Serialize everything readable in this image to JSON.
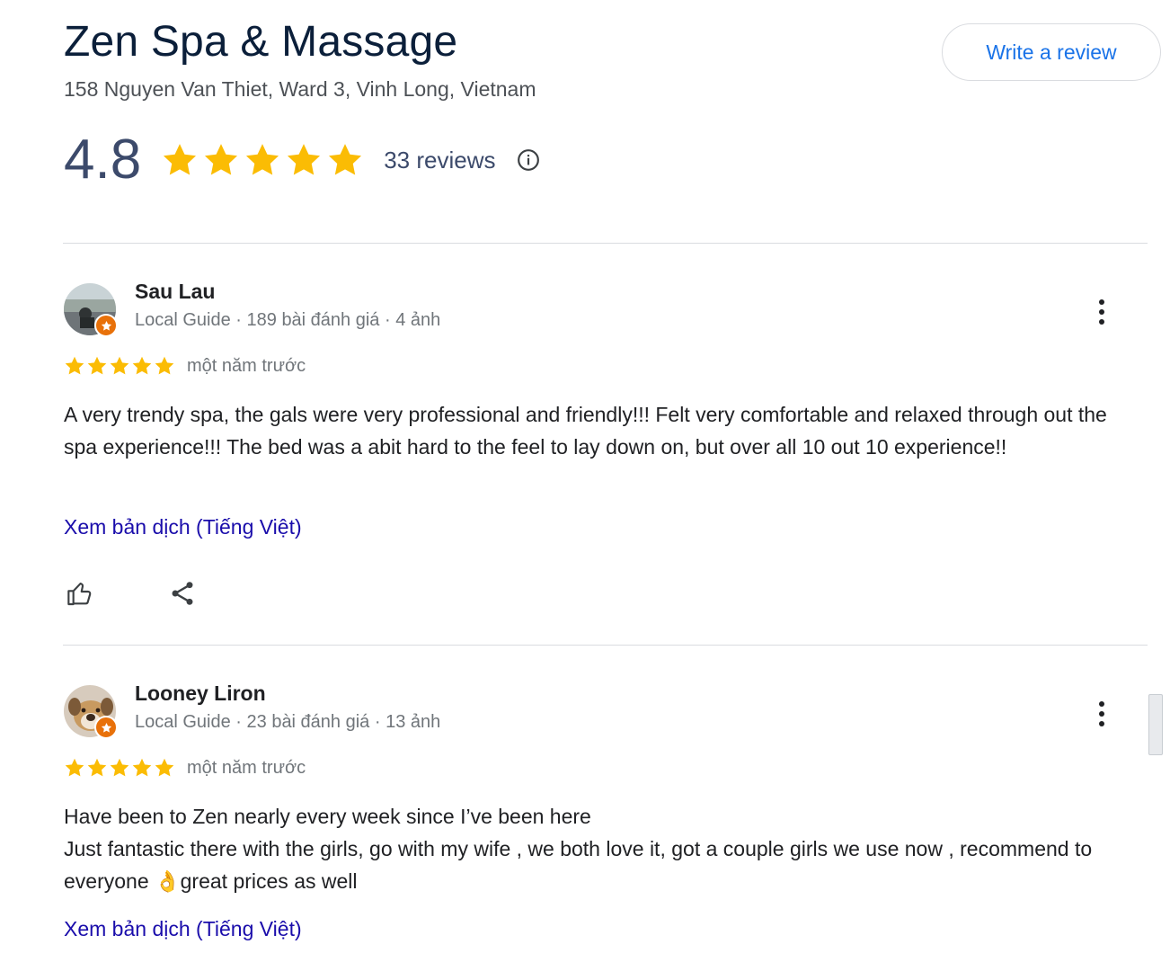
{
  "business": {
    "name": "Zen Spa & Massage",
    "address": "158 Nguyen Van Thiet, Ward 3, Vinh Long, Vietnam",
    "write_review_label": "Write a review",
    "rating": "4.8",
    "rating_stars": 5,
    "review_count": "33 reviews"
  },
  "colors": {
    "star": "#fbbc04",
    "link": "#1a0dab",
    "button_text": "#1a73e8",
    "guide_badge": "#e8710a"
  },
  "reviews": [
    {
      "name": "Sau Lau",
      "meta": "Local Guide · 189 bài đánh giá · 4 ảnh",
      "stars": 5,
      "date": "một năm trước",
      "text": "A very trendy spa, the gals were very professional and friendly!!! Felt very comfortable and relaxed through out the spa experience!!! The bed was a abit hard to the feel to lay down on, but over all 10 out 10 experience!!",
      "translate_label": "Xem bản dịch (Tiếng Việt)",
      "actions": [
        "thumbs-up-icon",
        "share-icon"
      ]
    },
    {
      "name": "Looney Liron",
      "meta": "Local Guide · 23 bài đánh giá · 13 ảnh",
      "stars": 5,
      "date": "một năm trước",
      "text": "Have been to Zen nearly every week since I’ve been here\nJust fantastic there with the girls, go with my wife , we both love it, got a couple girls we use now , recommend to everyone 👌great prices as well",
      "translate_label": "Xem bản dịch (Tiếng Việt)"
    }
  ]
}
